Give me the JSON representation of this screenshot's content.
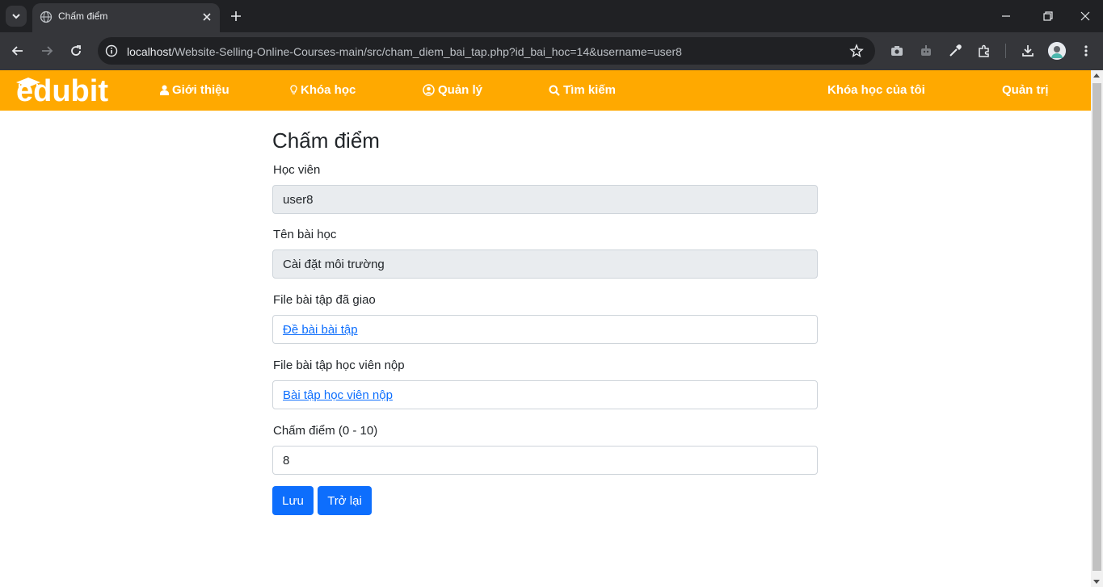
{
  "browser": {
    "tab_title": "Chấm điểm",
    "url_host": "localhost",
    "url_path": "/Website-Selling-Online-Courses-main/src/cham_diem_bai_tap.php?id_bai_hoc=14&username=user8"
  },
  "navbar": {
    "brand": "edubit",
    "items": [
      {
        "label": "Giới thiệu",
        "icon": "user-icon"
      },
      {
        "label": "Khóa học",
        "icon": "lightbulb-icon"
      },
      {
        "label": "Quản lý",
        "icon": "user-circle-icon"
      },
      {
        "label": "Tìm kiếm",
        "icon": "search-icon"
      },
      {
        "label": "Khóa học của tôi"
      },
      {
        "label": "Quản trị"
      }
    ],
    "color": "#ffa900"
  },
  "form": {
    "title": "Chấm điểm",
    "student_label": "Học viên",
    "student_value": "user8",
    "lesson_label": "Tên bài học",
    "lesson_value": "Cài đặt môi trường",
    "assigned_file_label": "File bài tập đã giao",
    "assigned_file_link": "Đề bài bài tập",
    "submitted_file_label": "File bài tập học viên nộp",
    "submitted_file_link": "Bài tập học viên nộp",
    "score_label": "Chấm điểm (0 - 10)",
    "score_value": "8",
    "save_label": "Lưu",
    "back_label": "Trở lại"
  },
  "colors": {
    "primary": "#0d6efd",
    "readonly_bg": "#e9ecef"
  }
}
